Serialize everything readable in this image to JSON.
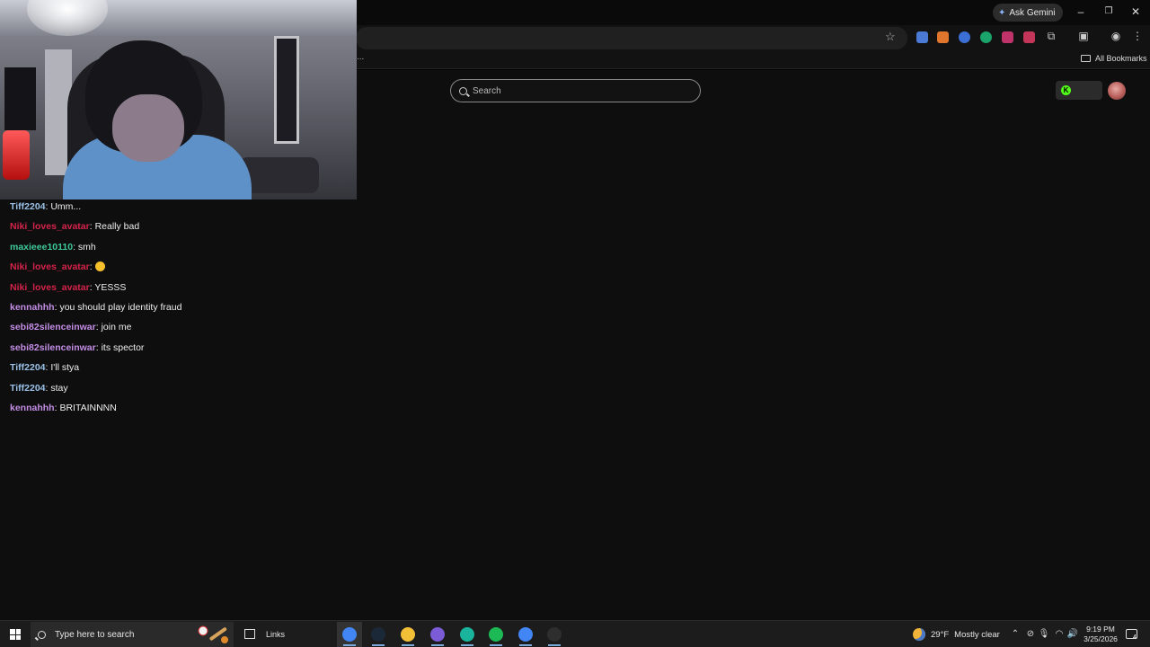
{
  "browser": {
    "ask_gemini_label": "Ask Gemini",
    "bookmarks_more": "...",
    "all_bookmarks_label": "All Bookmarks",
    "window_controls": {
      "minimize": "–",
      "restore": "❐",
      "close": "✕"
    },
    "extension_colors": [
      "#4a7ad6",
      "#e0762d",
      "#3b6fd6",
      "#1aa36a",
      "#c0336a",
      "#c4355a"
    ]
  },
  "site": {
    "search_placeholder": "Search",
    "accent_color": "#53fc18",
    "kick_logo_letter": "K"
  },
  "chat": {
    "messages": [
      {
        "user": "Tiff2204",
        "color": "#9bc2e8",
        "text": "Umm..."
      },
      {
        "user": "Niki_loves_avatar",
        "color": "#d4234a",
        "text": "Really bad"
      },
      {
        "user": "maxieee10110",
        "color": "#3ec99a",
        "text": "smh"
      },
      {
        "user": "Niki_loves_avatar",
        "color": "#d4234a",
        "text": "",
        "emoji": "slight-smile-emoji"
      },
      {
        "user": "Niki_loves_avatar",
        "color": "#d4234a",
        "text": "YESSS"
      },
      {
        "user": "kennahhh",
        "color": "#c48ee6",
        "text": "you should play identity fraud"
      },
      {
        "user": "sebi82silenceinwar",
        "color": "#c48ee6",
        "text": "join me"
      },
      {
        "user": "sebi82silenceinwar",
        "color": "#c48ee6",
        "text": "its spector"
      },
      {
        "user": "Tiff2204",
        "color": "#9bc2e8",
        "text": "I'll stya"
      },
      {
        "user": "Tiff2204",
        "color": "#9bc2e8",
        "text": "stay"
      },
      {
        "user": "kennahhh",
        "color": "#c48ee6",
        "text": "BRITAINNNN"
      }
    ]
  },
  "taskbar": {
    "search_placeholder": "Type here to search",
    "links_label": "Links",
    "apps": [
      {
        "name": "chrome-app",
        "color": "#4285f4",
        "active": true
      },
      {
        "name": "steam-app",
        "color": "#1b2838",
        "active": false
      },
      {
        "name": "file-explorer-app",
        "color": "#f2c037",
        "active": false
      },
      {
        "name": "discord-app",
        "color": "#7b5cd6",
        "active": false
      },
      {
        "name": "android-app",
        "color": "#19b49b",
        "active": false
      },
      {
        "name": "spotify-app",
        "color": "#1db954",
        "active": false
      },
      {
        "name": "chrome-profile-app",
        "color": "#4285f4",
        "active": false
      },
      {
        "name": "obs-app",
        "color": "#2e2e2e",
        "active": false
      }
    ],
    "weather": {
      "temperature": "29°F",
      "condition": "Mostly clear"
    },
    "clock": {
      "time": "9:19 PM",
      "date": "3/25/2026"
    },
    "notification_count": "4"
  }
}
